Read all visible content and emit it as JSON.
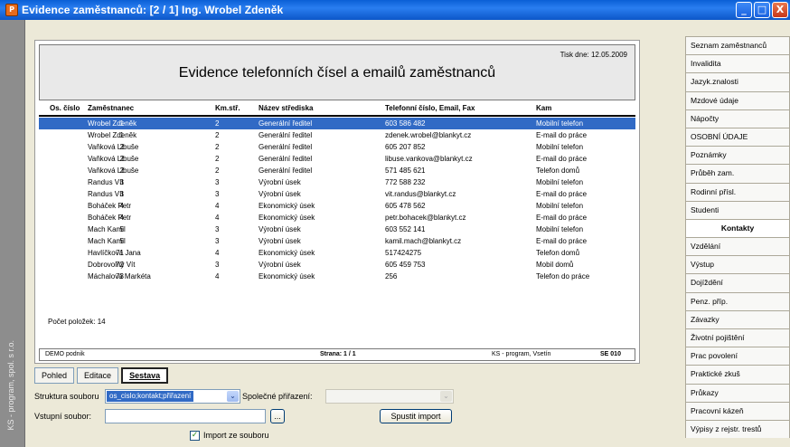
{
  "window": {
    "title": "Evidence zaměstnanců: [2 / 1] Ing. Wrobel Zdeněk",
    "app_icon_text": "P",
    "minimize_symbol": "_",
    "maximize_symbol": "□",
    "close_symbol": "X"
  },
  "left_strip": {
    "text": "KS - program, spol. s r.o."
  },
  "report": {
    "title": "Evidence telefonních čísel a emailů zaměstnanců",
    "print_date": "Tisk dne: 12.05.2009",
    "columns": [
      "Os. číslo",
      "Zaměstnanec",
      "Km.stř.",
      "Název střediska",
      "Telefonní číslo, Email, Fax",
      "Kam"
    ],
    "rows": [
      {
        "num": "1",
        "name": "Wrobel Zdeněk",
        "km": "2",
        "stredisko": "Generální ředitel",
        "tel": "603 586 482",
        "kam": "Mobilní telefon",
        "selected": true
      },
      {
        "num": "1",
        "name": "Wrobel Zdeněk",
        "km": "2",
        "stredisko": "Generální ředitel",
        "tel": "zdenek.wrobel@blankyt.cz",
        "kam": "E-mail do práce"
      },
      {
        "num": "2",
        "name": "Vaňková Libuše",
        "km": "2",
        "stredisko": "Generální ředitel",
        "tel": "605 207 852",
        "kam": "Mobilní telefon"
      },
      {
        "num": "2",
        "name": "Vaňková Libuše",
        "km": "2",
        "stredisko": "Generální ředitel",
        "tel": "libuse.vankova@blankyt.cz",
        "kam": "E-mail do práce"
      },
      {
        "num": "2",
        "name": "Vaňková Libuše",
        "km": "2",
        "stredisko": "Generální ředitel",
        "tel": "571 485 621",
        "kam": "Telefon domů"
      },
      {
        "num": "3",
        "name": "Randus Vít",
        "km": "3",
        "stredisko": "Výrobní úsek",
        "tel": "772 588 232",
        "kam": "Mobilní telefon"
      },
      {
        "num": "3",
        "name": "Randus Vít",
        "km": "3",
        "stredisko": "Výrobní úsek",
        "tel": "vit.randus@blankyt.cz",
        "kam": "E-mail do práce"
      },
      {
        "num": "4",
        "name": "Boháček Petr",
        "km": "4",
        "stredisko": "Ekonomický úsek",
        "tel": "605 478 562",
        "kam": "Mobilní telefon"
      },
      {
        "num": "4",
        "name": "Boháček Petr",
        "km": "4",
        "stredisko": "Ekonomický úsek",
        "tel": "petr.bohacek@blankyt.cz",
        "kam": "E-mail do práce"
      },
      {
        "num": "5",
        "name": "Mach Kamil",
        "km": "3",
        "stredisko": "Výrobní úsek",
        "tel": "603 552 141",
        "kam": "Mobilní telefon"
      },
      {
        "num": "5",
        "name": "Mach Kamil",
        "km": "3",
        "stredisko": "Výrobní úsek",
        "tel": "kamil.mach@blankyt.cz",
        "kam": "E-mail do práce"
      },
      {
        "num": "71",
        "name": "Havlíčková Jana",
        "km": "4",
        "stredisko": "Ekonomický úsek",
        "tel": "517424275",
        "kam": "Telefon domů"
      },
      {
        "num": "72",
        "name": "Dobrovolný Vít",
        "km": "3",
        "stredisko": "Výrobní úsek",
        "tel": "605 459 753",
        "kam": "Mobil domů"
      },
      {
        "num": "73",
        "name": "Máchalová Markéta",
        "km": "4",
        "stredisko": "Ekonomický úsek",
        "tel": "256",
        "kam": "Telefon do práce"
      }
    ],
    "count_label": "Počet položek: 14",
    "footer": {
      "company": "DEMO podnik",
      "page": "Strana: 1 / 1",
      "vendor": "KS - program, Vsetín",
      "code": "SE 010"
    }
  },
  "tabs": [
    {
      "label": "Pohled"
    },
    {
      "label": "Editace"
    },
    {
      "label": "Sestava",
      "active": true
    }
  ],
  "form": {
    "structure_label": "Struktura souboru",
    "structure_value": "os_cislo;kontakt;přiřazení",
    "common_label": "Společné přiřazení:",
    "input_file_label": "Vstupní soubor:",
    "browse_label": "...",
    "import_button": "Spustit import",
    "import_checkbox_label": "Import ze souboru",
    "check_symbol": "✓",
    "arrow_symbol": "⌄"
  },
  "sidebar": {
    "items": [
      {
        "label": "Seznam zaměstnanců"
      },
      {
        "label": "Invalidita"
      },
      {
        "label": "Jazyk.znalosti"
      },
      {
        "label": "Mzdové údaje"
      },
      {
        "label": "Nápočty"
      },
      {
        "label": "OSOBNÍ ÚDAJE"
      },
      {
        "label": "Poznámky"
      },
      {
        "label": "Průběh zam."
      },
      {
        "label": "Rodinní přísl."
      },
      {
        "label": "Studenti"
      },
      {
        "label": "Kontakty",
        "active": true
      },
      {
        "label": "Vzdělání"
      },
      {
        "label": "Výstup"
      },
      {
        "label": "Dojíždění"
      },
      {
        "label": "Penz. příp."
      },
      {
        "label": "Závazky"
      },
      {
        "label": "Životní pojištění"
      },
      {
        "label": "Prac povolení"
      },
      {
        "label": "Praktické zkuš"
      },
      {
        "label": "Průkazy"
      },
      {
        "label": "Pracovní kázeň"
      },
      {
        "label": "Výpisy z rejstr. trestů"
      }
    ]
  }
}
